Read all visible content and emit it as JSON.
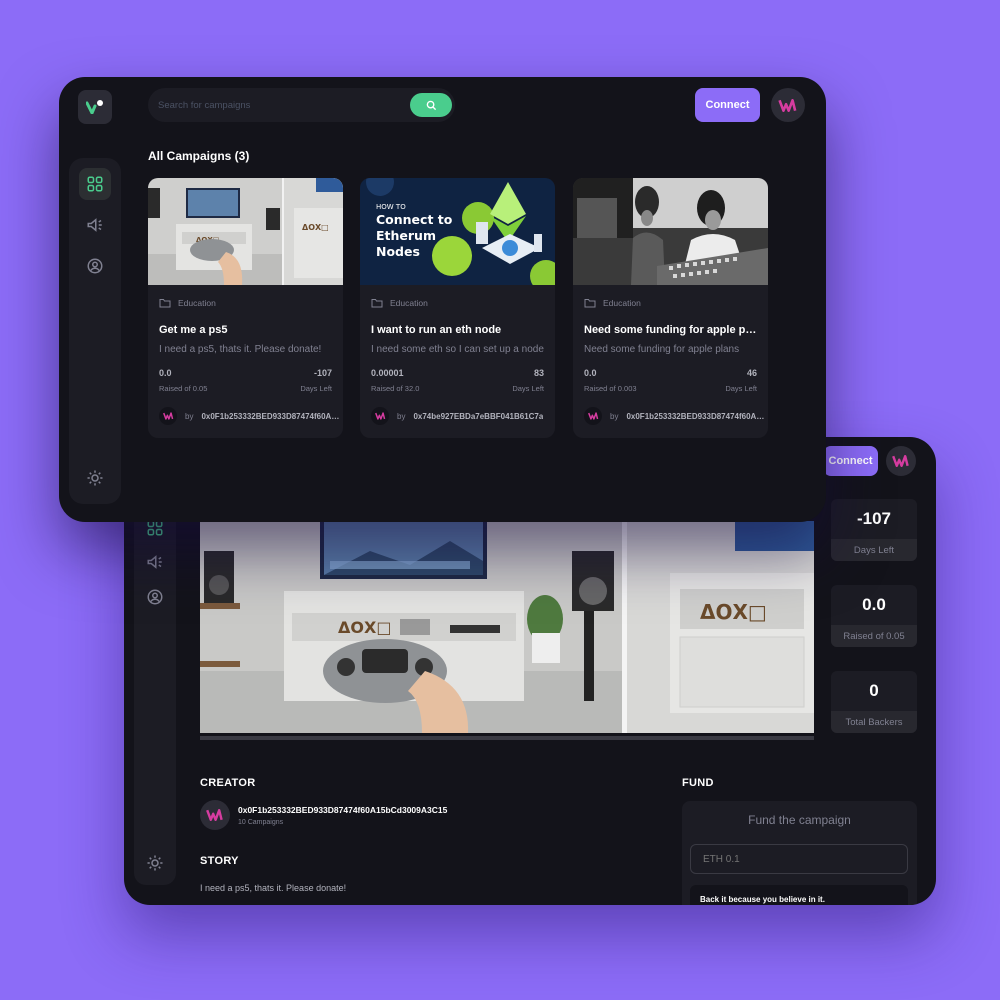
{
  "back_window": {
    "connect_label": "Connect",
    "stats": [
      {
        "value": "-107",
        "label": "Days Left"
      },
      {
        "value": "0.0",
        "label": "Raised of 0.05"
      },
      {
        "value": "0",
        "label": "Total Backers"
      }
    ],
    "creator_heading": "CREATOR",
    "creator_address": "0x0F1b253332BED933D87474f60A15bCd3009A3C15",
    "creator_campaigns": "10 Campaigns",
    "story_heading": "STORY",
    "story_text": "I need a ps5, thats it. Please donate!",
    "fund_heading": "FUND",
    "fund_box_title": "Fund the campaign",
    "fund_input_placeholder": "ETH 0.1",
    "fund_note": "Back it because you believe in it.",
    "hero_image": {
      "icon": "ps-logo",
      "text": "ΔΟΧ□"
    }
  },
  "front_window": {
    "search": {
      "placeholder": "Search for campaigns"
    },
    "connect_label": "Connect",
    "page_title": "All Campaigns (3)",
    "campaigns": [
      {
        "category": "Education",
        "title": "Get me a ps5",
        "description": "I need a ps5, thats it. Please donate!",
        "raised": "0.0",
        "raised_label": "Raised of 0.05",
        "days": "-107",
        "days_label": "Days Left",
        "owner_prefix": "by",
        "owner": "0x0F1b253332BED933D87474f60A15bCd3009A3C15",
        "image_text": "ΔΟΧ□"
      },
      {
        "category": "Education",
        "title": "I want to run an eth node",
        "description": "I need some eth so I can set up a node",
        "raised": "0.00001",
        "raised_label": "Raised of 32.0",
        "days": "83",
        "days_label": "Days Left",
        "owner_prefix": "by",
        "owner": "0x74be927EBDa7eBBF041B61C7a",
        "image_line1": "HOW TO",
        "image_line2": "Connect to",
        "image_line3": "Etherum",
        "image_line4": "Nodes"
      },
      {
        "category": "Education",
        "title": "Need some funding for apple plans",
        "description": "Need some funding for apple plans",
        "raised": "0.0",
        "raised_label": "Raised of 0.003",
        "days": "46",
        "days_label": "Days Left",
        "owner_prefix": "by",
        "owner": "0x0F1b253332BED933D87474f60A15bCd3009A3C15"
      }
    ]
  },
  "colors": {
    "background": "#8c6cf7",
    "window": "#13131a",
    "panel": "#1c1c24",
    "accent_green": "#4acd8d",
    "accent_purple": "#8c6cf7"
  }
}
